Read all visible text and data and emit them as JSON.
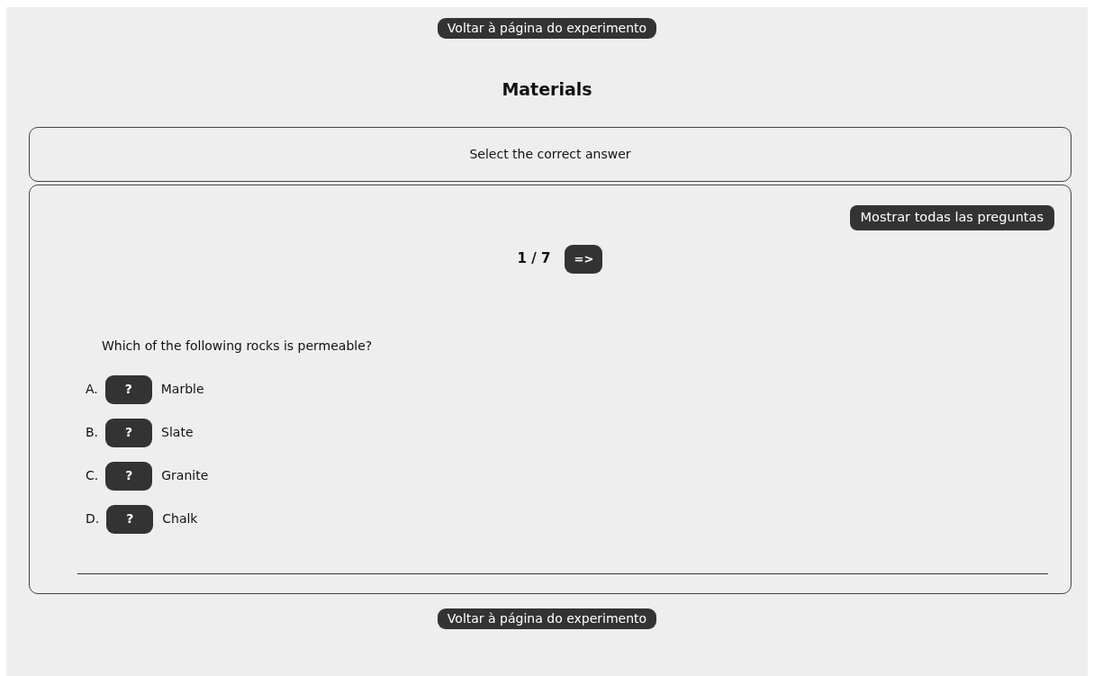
{
  "top_button": "Voltar à página do experimento",
  "title": "Materials",
  "instruction": "Select the correct answer",
  "show_all_button": "Mostrar todas las preguntas",
  "counter": "1 / 7",
  "next_button": "=>",
  "question": "Which of the following rocks is permeable?",
  "options": [
    {
      "letter": "A.",
      "button": "?",
      "text": "Marble"
    },
    {
      "letter": "B.",
      "button": "?",
      "text": "Slate"
    },
    {
      "letter": "C.",
      "button": "?",
      "text": "Granite"
    },
    {
      "letter": "D.",
      "button": "?",
      "text": "Chalk"
    }
  ],
  "bottom_button": "Voltar à página do experimento"
}
